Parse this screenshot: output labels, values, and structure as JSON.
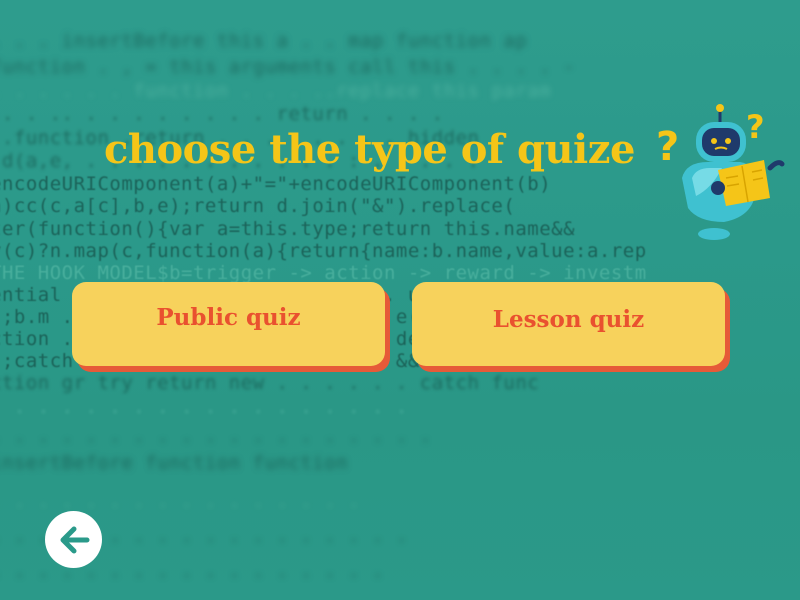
{
  "background": {
    "code_lines": [
      "  . . .     insertBefore  this    a  .  .     map  function   ap",
      " function  . , = this   arguments  call  this  . . .  .  -",
      "   . . . .  .  .  function . .  .  ..replace  this  param",
      "  ..  .  ..  .  .  .  .  . .  .  .  return    .  .  .  .",
      "  ..function  .return .  .  .  .  .  .  .  .  hidden  .",
      "'d(a,e,  .  .  .  .  .  .  .  .  .  . . : .  .  .  .  .",
      "encodeURIComponent(a)+\"=\"+encodeURIComponent(b)",
      "  a)cc(c,a[c],b,e);return d.join(\"&\").replace(",
      "ter(function(){var a=this.type;return this.name&&",
      "y(c)?n.map(c,function(a){return{name:b.name,value:a.rep",
      " THE HOOK MODEL$b=trigger -> action -> reward -> investm",
      "ential  .  .  .  .  .  .  .  .  .  .  .  .  .  .  unctio",
      "(;b.m  .  .  .  .  .  .  .  .  .  .  .  .  .  .  e(b.m",
      "ction  .  .  .  .  .  .  .  .  .  .  .  .  .  .  delet",
      "(;catch  .  .  .  .  .  .  .  .  .  .  .  .  .  &&(f",
      "ction gr  try return new  .  .  .  .  .  .  catch  func",
      "  .  .  .  .  .  .  .  .  .  .  .  .  .  .  .  .  .  .",
      "  . . . .  .   .  .  . .  .  .  .  .  .  .  .  .  .  .",
      "      insertBefore    function      function    ",
      "   . .  .  .  .  .  .   .   .  .  .  .  .  .  .  .",
      "  . .  .  .  .  . .  .  .  .  .  .  .  .  .  .  .  .",
      "   .  .  .  .  .  .  .  .  .  .  .  .  .  .  .  .  ."
    ]
  },
  "header": {
    "title": "choose the type of quize"
  },
  "options": [
    {
      "label": "Public quiz"
    },
    {
      "label": "Lesson quiz"
    }
  ],
  "navigation": {
    "back_icon": "arrow-left-icon"
  },
  "mascot": {
    "icon": "robot-question-icon"
  },
  "colors": {
    "title": "#f5c518",
    "button_bg": "#f7d25c",
    "button_shadow": "#e65a38",
    "button_text": "#e9512f",
    "back_arrow": "#2a9a8a"
  }
}
